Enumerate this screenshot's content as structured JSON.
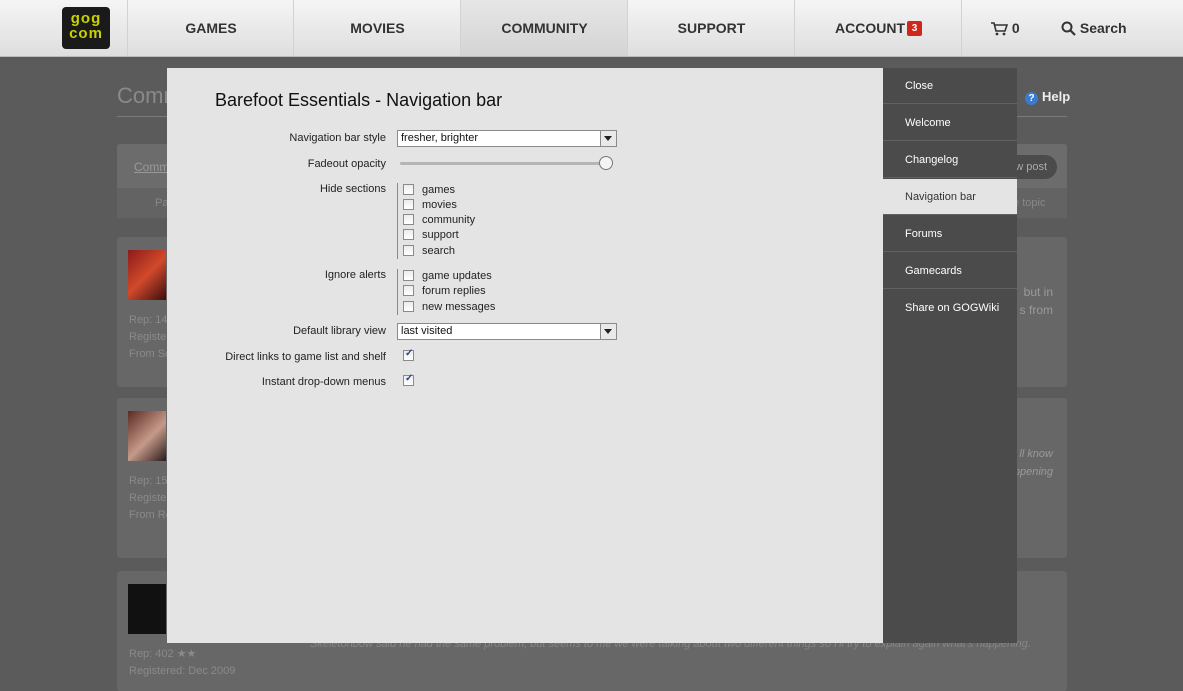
{
  "topnav": {
    "logo_top": "gog",
    "logo_bottom": "com",
    "items": [
      {
        "label": "GAMES"
      },
      {
        "label": "MOVIES"
      },
      {
        "label": "COMMUNITY"
      },
      {
        "label": "SUPPORT"
      },
      {
        "label": "ACCOUNT",
        "badge": "3"
      }
    ],
    "cart_count": "0",
    "search_label": "Search"
  },
  "background": {
    "title": "Comm",
    "help": "Help",
    "subnav": "Comm",
    "new_post": "w post",
    "pa": "Pa",
    "topic": "te topic",
    "posts": [
      {
        "meta": [
          "Rep: 14",
          "Register",
          "From Sc"
        ],
        "text": [
          "but in",
          "s from"
        ]
      },
      {
        "meta": [
          "Rep: 15",
          "Registe",
          "From Re"
        ],
        "text": [
          "ll know",
          "ppening"
        ]
      },
      {
        "meta": [
          "Rep: 402 ★★",
          "Registered: Dec 2009"
        ]
      }
    ],
    "footer_line": "Skeletonbow said he had the same problem, but seems to me we were talking about two different things so I'll try to explain again what's happening."
  },
  "modal": {
    "title": "Barefoot Essentials - Navigation bar",
    "nav_style_label": "Navigation bar style",
    "nav_style_value": "fresher, brighter",
    "fade_label": "Fadeout opacity",
    "fade_value": 1.0,
    "hide_label": "Hide sections",
    "hide_sections": [
      "games",
      "movies",
      "community",
      "support",
      "search"
    ],
    "ignore_label": "Ignore alerts",
    "ignore_alerts": [
      "game updates",
      "forum replies",
      "new messages"
    ],
    "library_label": "Default library view",
    "library_value": "last visited",
    "direct_links_label": "Direct links to game list and shelf",
    "direct_links_checked": true,
    "instant_label": "Instant drop-down menus",
    "instant_checked": true
  },
  "sidebar": {
    "items": [
      {
        "label": "Close"
      },
      {
        "label": "Welcome"
      },
      {
        "label": "Changelog"
      },
      {
        "label": "Navigation bar",
        "active": true
      },
      {
        "label": "Forums"
      },
      {
        "label": "Gamecards"
      },
      {
        "label": "Share on GOGWiki"
      }
    ]
  }
}
